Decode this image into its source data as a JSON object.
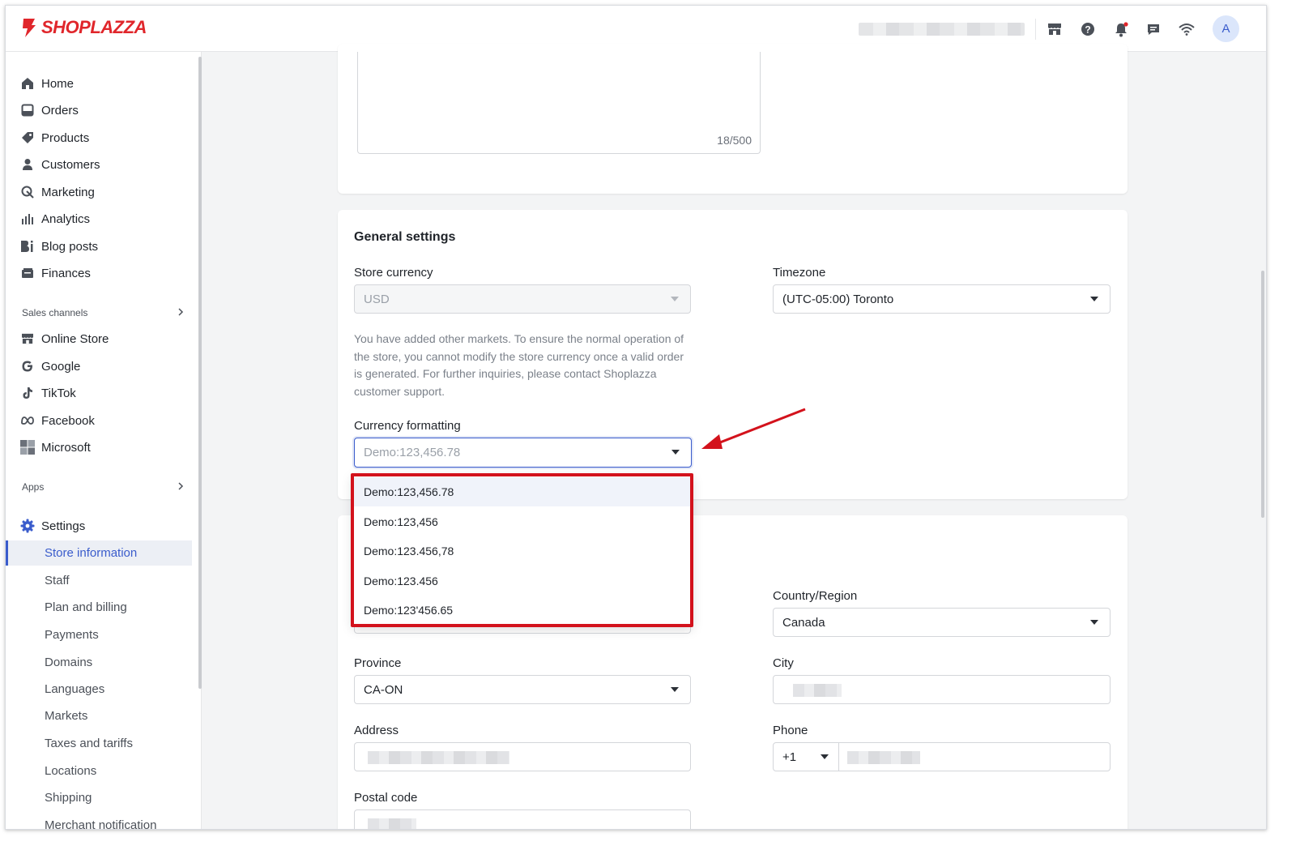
{
  "brand": {
    "name": "SHOPLAZZA",
    "color": "#e0262b"
  },
  "topbar": {
    "icons": [
      "store-icon",
      "help-icon",
      "bell-icon",
      "chat-icon",
      "wifi-icon"
    ],
    "avatar_initial": "A"
  },
  "sidebar": {
    "main_items": [
      {
        "label": "Home",
        "icon": "home-icon"
      },
      {
        "label": "Orders",
        "icon": "orders-icon"
      },
      {
        "label": "Products",
        "icon": "tag-icon"
      },
      {
        "label": "Customers",
        "icon": "person-icon"
      },
      {
        "label": "Marketing",
        "icon": "marketing-icon"
      },
      {
        "label": "Analytics",
        "icon": "bar-chart-icon"
      },
      {
        "label": "Blog posts",
        "icon": "blog-icon"
      },
      {
        "label": "Finances",
        "icon": "finances-icon"
      }
    ],
    "sales_channels_header": "Sales channels",
    "sales_channels": [
      {
        "label": "Online Store",
        "icon": "store-icon"
      },
      {
        "label": "Google",
        "icon": "google-icon"
      },
      {
        "label": "TikTok",
        "icon": "tiktok-icon"
      },
      {
        "label": "Facebook",
        "icon": "meta-icon"
      },
      {
        "label": "Microsoft",
        "icon": "microsoft-icon"
      }
    ],
    "apps_header": "Apps",
    "settings_label": "Settings",
    "settings_items": [
      {
        "label": "Store information",
        "active": true
      },
      {
        "label": "Staff"
      },
      {
        "label": "Plan and billing"
      },
      {
        "label": "Payments"
      },
      {
        "label": "Domains"
      },
      {
        "label": "Languages"
      },
      {
        "label": "Markets"
      },
      {
        "label": "Taxes and tariffs"
      },
      {
        "label": "Locations"
      },
      {
        "label": "Shipping"
      },
      {
        "label": "Merchant notification"
      }
    ]
  },
  "description": {
    "counter": "18/500"
  },
  "general_settings": {
    "title": "General settings",
    "store_currency_label": "Store currency",
    "store_currency_value": "USD",
    "timezone_label": "Timezone",
    "timezone_value": "(UTC-05:00) Toronto",
    "currency_help": "You have added other markets. To ensure the normal operation of the store, you cannot modify the store currency once a valid order is generated. For further inquiries, please contact Shoplazza customer support.",
    "currency_formatting_label": "Currency formatting",
    "currency_formatting_value": "Demo:123,456.78",
    "currency_formatting_options": [
      "Demo:123,456.78",
      "Demo:123,456",
      "Demo:123.456,78",
      "Demo:123.456",
      "Demo:123'456.65"
    ]
  },
  "address": {
    "country_label": "Country/Region",
    "country_value": "Canada",
    "province_label": "Province",
    "province_value": "CA-ON",
    "city_label": "City",
    "address_label": "Address",
    "phone_label": "Phone",
    "phone_code": "+1",
    "postal_label": "Postal code"
  },
  "annotation": {
    "highlight_color": "#d3121c"
  }
}
